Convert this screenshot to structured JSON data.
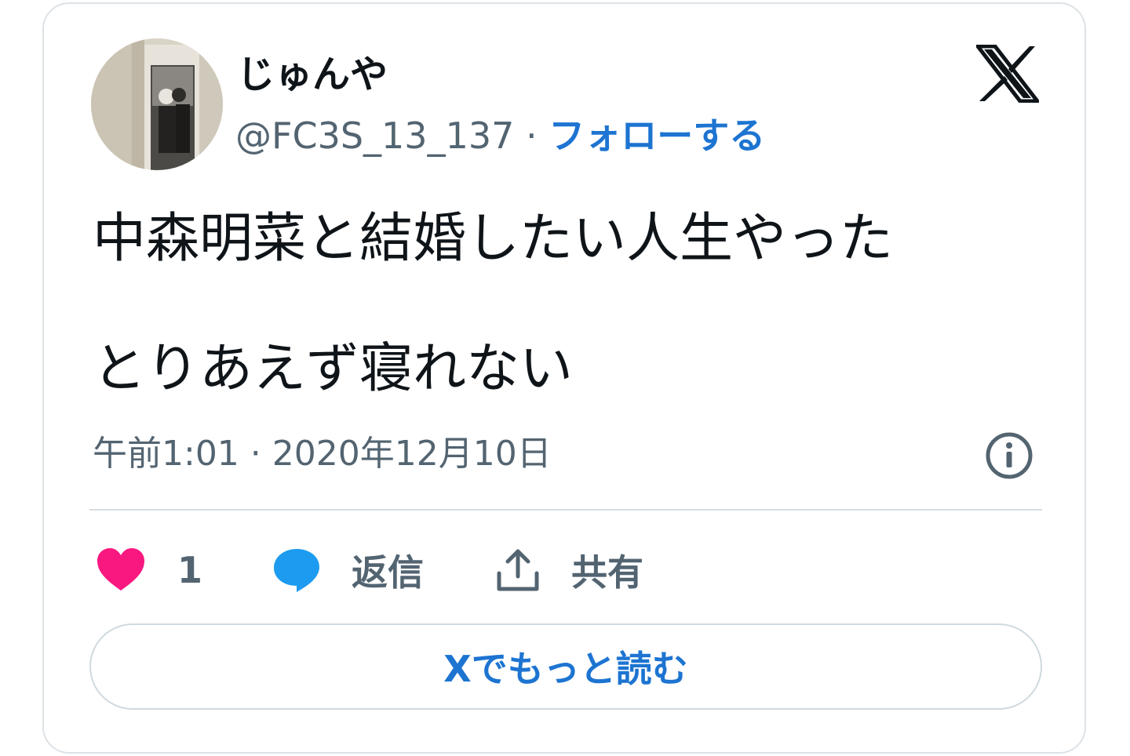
{
  "author": {
    "display_name": "じゅんや",
    "handle": "@FC3S_13_137",
    "separator": " · ",
    "follow_label": "フォローする"
  },
  "tweet": {
    "line1": "中森明菜と結婚したい人生やった",
    "line2": "とりあえず寝れない"
  },
  "timestamp": "午前1:01 · 2020年12月10日",
  "actions": {
    "like_count": "1",
    "reply_label": "返信",
    "share_label": "共有"
  },
  "read_more_label": "Xでもっと読む",
  "colors": {
    "accent": "#1d74d1",
    "like": "#f91880",
    "reply": "#1d9bf0",
    "muted": "#536471",
    "text": "#0f1419"
  },
  "icons": {
    "logo": "x-logo-icon",
    "info": "info-icon",
    "like": "heart-icon",
    "reply": "speech-bubble-icon",
    "share": "share-upload-icon"
  }
}
